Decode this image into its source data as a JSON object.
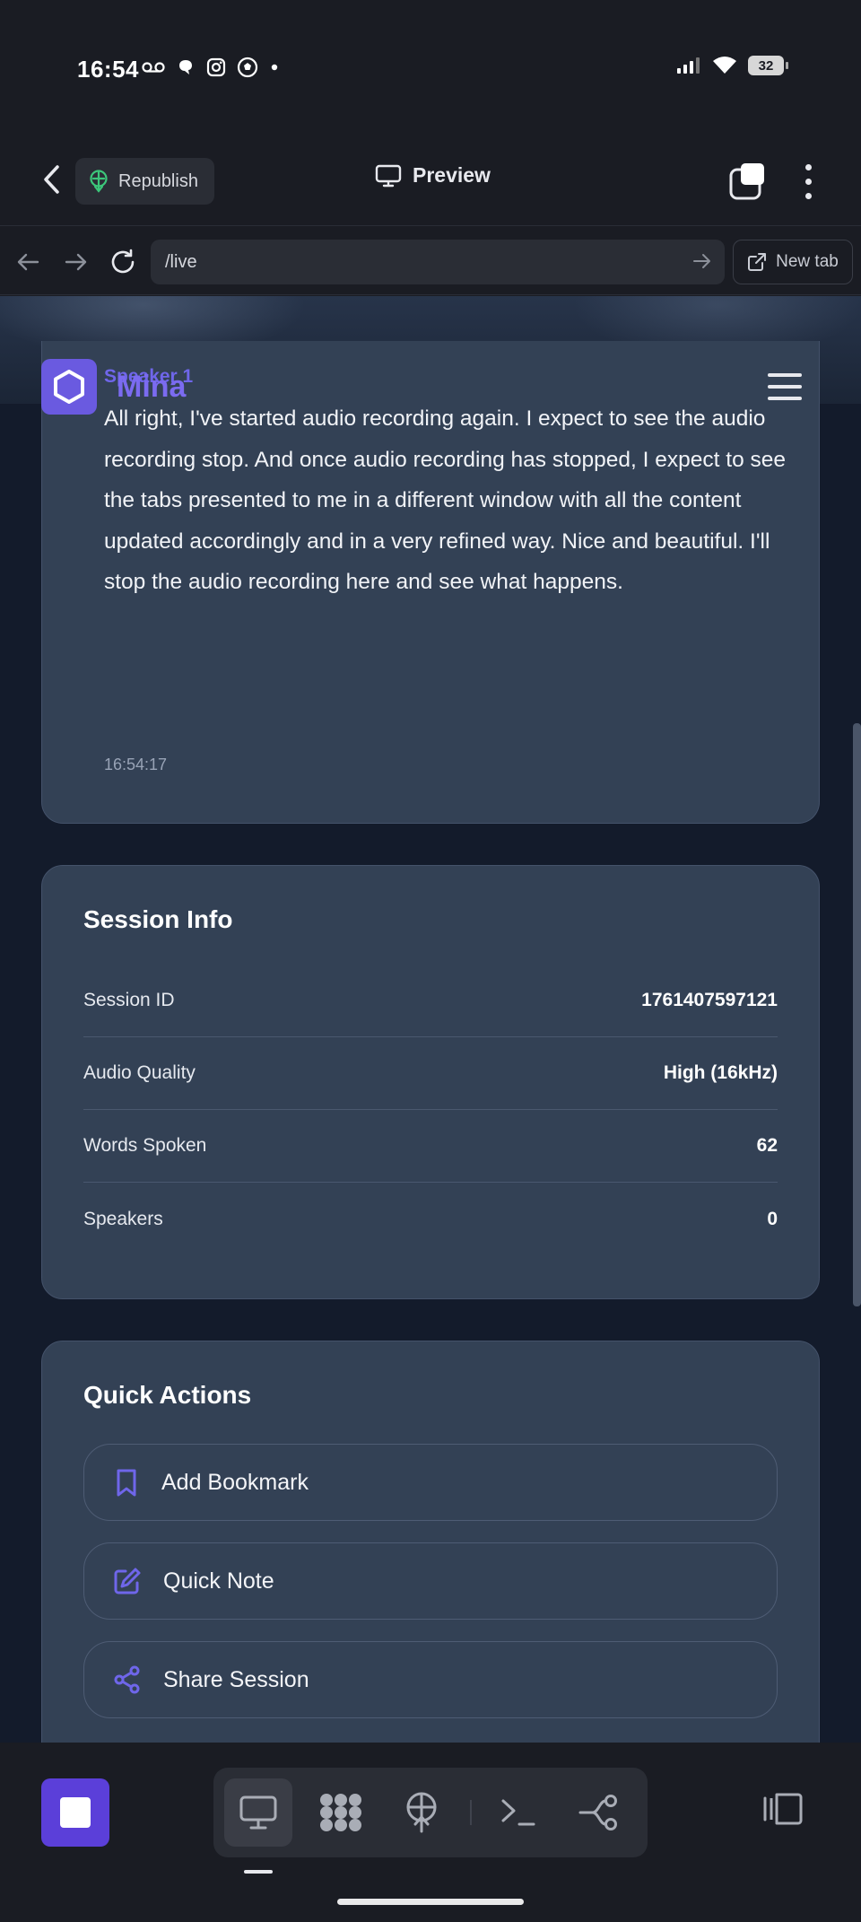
{
  "status_bar": {
    "time": "16:54",
    "battery": "32",
    "left_icons": [
      "voicemail-icon",
      "threads-icon",
      "instagram-icon",
      "soccer-ball-icon",
      "dot-icon"
    ],
    "right_icons": [
      "signal-icon",
      "wifi-icon",
      "battery-icon"
    ]
  },
  "appbar": {
    "republish_label": "Republish",
    "preview_label": "Preview"
  },
  "urlbar": {
    "url": "/live",
    "new_tab_label": "New tab"
  },
  "site": {
    "brand": "Mina"
  },
  "transcript": {
    "speaker": "Speaker 1",
    "text": "All right, I've started audio recording again. I expect to see the audio recording stop. And once audio recording has stopped, I expect to see the tabs presented to me in a different window with all the content updated accordingly and in a very refined way. Nice and beautiful. I'll stop the audio recording here and see what happens.",
    "timestamp": "16:54:17"
  },
  "session_info": {
    "title": "Session Info",
    "rows": [
      {
        "label": "Session ID",
        "value": "1761407597121"
      },
      {
        "label": "Audio Quality",
        "value": "High (16kHz)"
      },
      {
        "label": "Words Spoken",
        "value": "62"
      },
      {
        "label": "Speakers",
        "value": "0"
      }
    ]
  },
  "quick_actions": {
    "title": "Quick Actions",
    "items": [
      {
        "label": "Add Bookmark",
        "icon": "bookmark-icon"
      },
      {
        "label": "Quick Note",
        "icon": "edit-icon"
      },
      {
        "label": "Share Session",
        "icon": "share-icon"
      }
    ]
  },
  "colors": {
    "accent": "#6f66ea",
    "card": "#334155",
    "page": "#131b2b",
    "stop_button": "#5b3fd9"
  }
}
